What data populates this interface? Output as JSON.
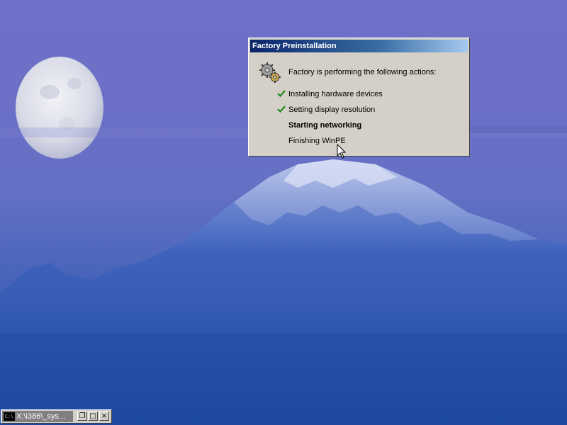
{
  "dialog": {
    "title": "Factory Preinstallation",
    "header": "Factory is performing the following actions:",
    "actions": [
      {
        "label": "Installing hardware devices",
        "status": "done"
      },
      {
        "label": "Setting display resolution",
        "status": "done"
      },
      {
        "label": "Starting networking",
        "status": "in-progress"
      },
      {
        "label": "Finishing WinPE",
        "status": "pending"
      }
    ]
  },
  "console": {
    "icon": "cmd-icon",
    "icon_text": "C:\\",
    "title": "X:\\i386\\_sys..."
  },
  "colors": {
    "titlebar_start": "#0a246a",
    "titlebar_end": "#a6caf0",
    "dialog_face": "#d4d0c8",
    "check": "#1f8a1f"
  }
}
